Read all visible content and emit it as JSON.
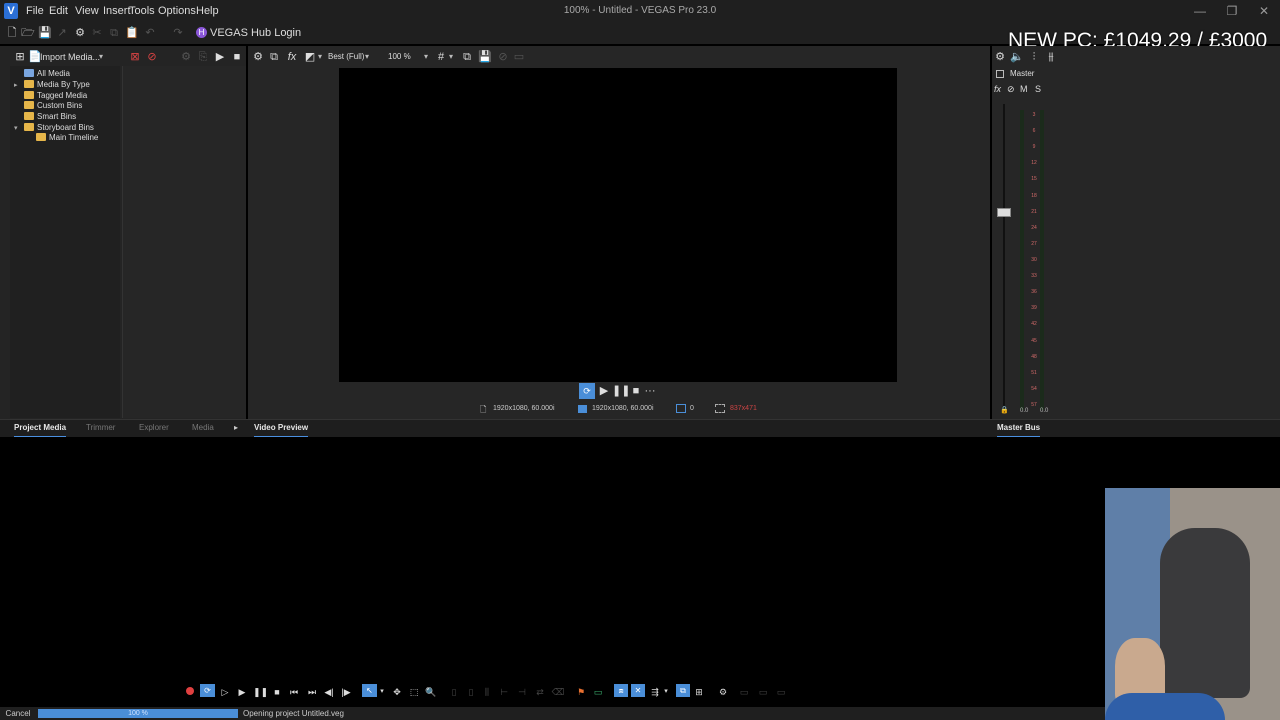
{
  "app": {
    "logo_letter": "V",
    "window_title": "100% - Untitled - VEGAS Pro 23.0",
    "menu": [
      "File",
      "Edit",
      "View",
      "Insert",
      "Tools",
      "Options",
      "Help"
    ],
    "window_buttons": [
      "—",
      "❐",
      "✕"
    ]
  },
  "toolbar": {
    "hub_login": "VEGAS Hub Login"
  },
  "project_media": {
    "import_label": "Import Media...",
    "tree": [
      {
        "label": "All Media",
        "expander": ""
      },
      {
        "label": "Media By Type",
        "expander": "▸"
      },
      {
        "label": "Tagged Media",
        "expander": ""
      },
      {
        "label": "Custom Bins",
        "expander": ""
      },
      {
        "label": "Smart Bins",
        "expander": ""
      },
      {
        "label": "Storyboard Bins",
        "expander": "▾"
      },
      {
        "label": "Main Timeline",
        "expander": ""
      }
    ]
  },
  "video_preview": {
    "quality": "Best (Full)",
    "zoom": "100 %",
    "project_res": "1920x1080, 60.000i",
    "preview_res": "1920x1080, 60.000i",
    "frame": "0",
    "display_size": "837x471"
  },
  "mixer": {
    "master_label": "Master",
    "fx_label": "fx",
    "m_label": "M",
    "s_label": "S",
    "meter_scale": [
      "3",
      "6",
      "9",
      "12",
      "15",
      "18",
      "21",
      "24",
      "27",
      "30",
      "33",
      "36",
      "39",
      "42",
      "45",
      "48",
      "51",
      "54",
      "57"
    ],
    "left_level": "0.0",
    "right_level": "0.0"
  },
  "tabs": {
    "project_media": "Project Media",
    "trimmer": "Trimmer",
    "explorer": "Explorer",
    "media": "Media",
    "video_preview": "Video Preview",
    "master_bus": "Master Bus"
  },
  "status": {
    "cancel": "Cancel",
    "progress_percent": 100,
    "progress_label": "100 %",
    "message": "Opening project Untitled.veg"
  },
  "overlay": {
    "text": "NEW PC: £1049.29 / £3000"
  },
  "colors": {
    "accent": "#4a8ed8",
    "hub": "#8a56d8",
    "folder": "#e6b64a",
    "record": "#e04040"
  }
}
